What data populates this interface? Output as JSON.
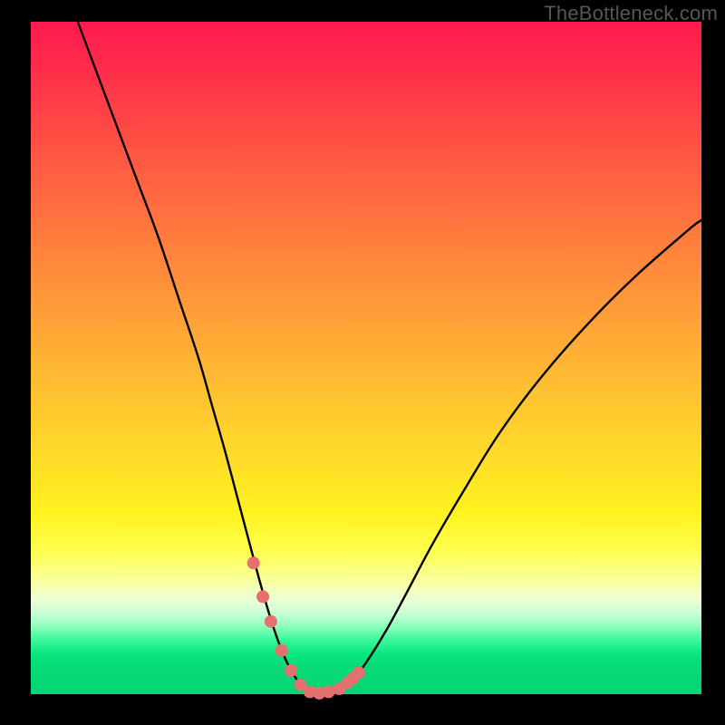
{
  "watermark": "TheBottleneck.com",
  "chart_data": {
    "type": "line",
    "title": "",
    "xlabel": "",
    "ylabel": "",
    "xlim": [
      0,
      100
    ],
    "ylim": [
      0,
      100
    ],
    "curve": {
      "x": [
        7,
        10,
        13,
        16,
        19,
        22,
        25,
        27,
        29,
        31,
        33,
        34.5,
        36,
        37.5,
        39,
        40.5,
        42,
        44,
        46,
        48,
        50,
        53,
        56,
        60,
        65,
        70,
        76,
        83,
        90,
        98,
        100
      ],
      "y": [
        100,
        92,
        84,
        76,
        68,
        59,
        50,
        43,
        36,
        28.5,
        21,
        15.5,
        10.5,
        6.3,
        3.2,
        1.2,
        0.3,
        0.15,
        0.7,
        2.2,
        4.7,
        9.5,
        15,
        22.5,
        31,
        39,
        47,
        55,
        62,
        69,
        70.5
      ]
    },
    "markers": {
      "x": [
        33.2,
        34.6,
        35.8,
        37.4,
        38.8,
        40.2,
        41.6,
        43.0,
        44.4,
        46.0,
        47.2,
        48.0,
        48.9
      ],
      "y": [
        19.5,
        14.5,
        10.8,
        6.5,
        3.5,
        1.4,
        0.35,
        0.15,
        0.35,
        0.8,
        1.7,
        2.3,
        3.2
      ],
      "color": "#e4716f",
      "radius_px": 7
    },
    "gradient_stops": [
      {
        "pos": 0.0,
        "color": "#ff1a4f"
      },
      {
        "pos": 0.24,
        "color": "#ff6342"
      },
      {
        "pos": 0.54,
        "color": "#ffbe32"
      },
      {
        "pos": 0.73,
        "color": "#fff21e"
      },
      {
        "pos": 0.86,
        "color": "#eaffd6"
      },
      {
        "pos": 1.0,
        "color": "#05d574"
      }
    ]
  }
}
